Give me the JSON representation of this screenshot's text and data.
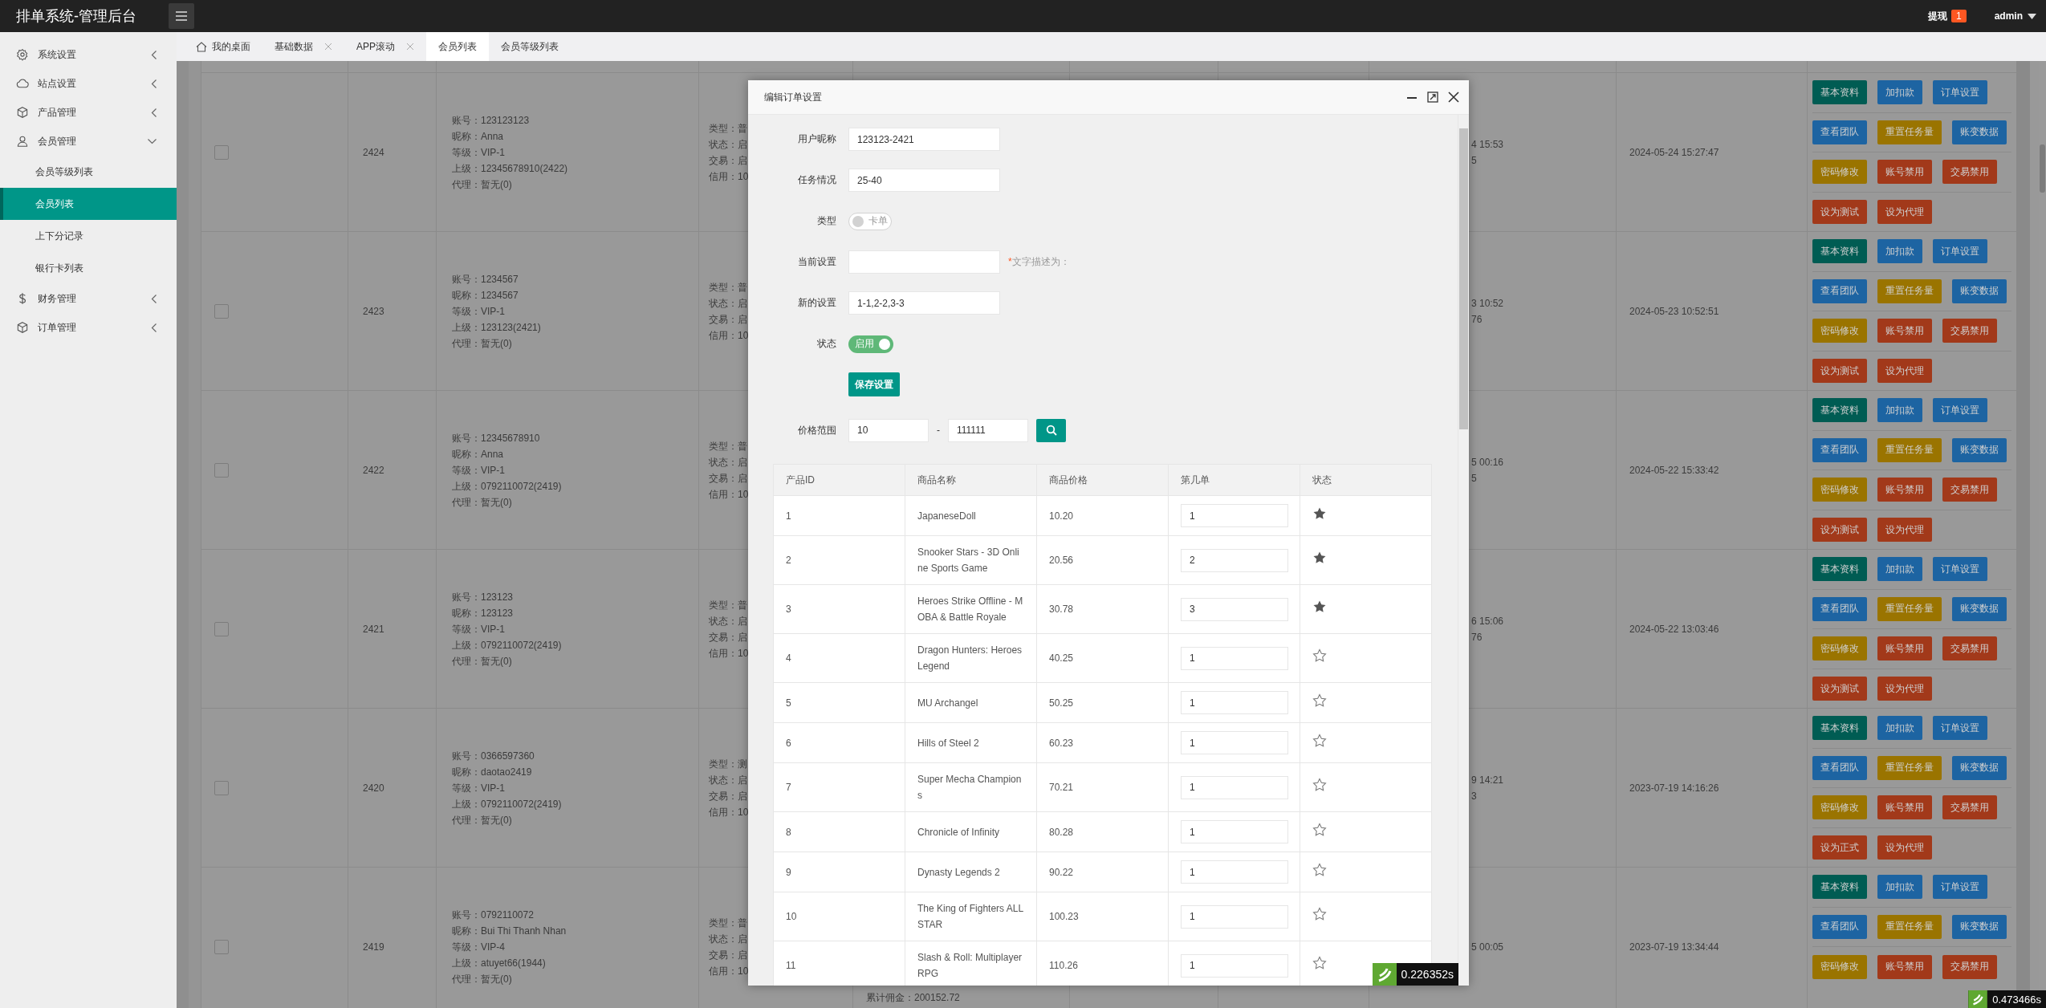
{
  "header": {
    "title": "排单系统-管理后台",
    "withdraw": {
      "label": "提现",
      "count": "1"
    },
    "user": "admin"
  },
  "sidebar": {
    "items": [
      {
        "label": "系统设置",
        "kind": "gear",
        "expanded": false
      },
      {
        "label": "站点设置",
        "kind": "cloud",
        "expanded": false
      },
      {
        "label": "产品管理",
        "kind": "cube",
        "expanded": false
      },
      {
        "label": "会员管理",
        "kind": "user",
        "expanded": true,
        "children": [
          {
            "label": "会员等级列表",
            "selected": false
          },
          {
            "label": "会员列表",
            "selected": true
          },
          {
            "label": "上下分记录",
            "selected": false
          },
          {
            "label": "银行卡列表",
            "selected": false
          }
        ]
      },
      {
        "label": "财务管理",
        "kind": "dollar",
        "expanded": false
      },
      {
        "label": "订单管理",
        "kind": "cube",
        "expanded": false
      }
    ]
  },
  "tabs": [
    {
      "label": "我的桌面",
      "kind": "home",
      "closable": false,
      "selected": false
    },
    {
      "label": "基础数据",
      "kind": "page",
      "closable": true,
      "selected": false
    },
    {
      "label": "APP滚动",
      "kind": "page",
      "closable": true,
      "selected": false
    },
    {
      "label": "会员列表",
      "kind": "page",
      "closable": false,
      "selected": true
    },
    {
      "label": "会员等级列表",
      "kind": "page",
      "closable": false,
      "selected": false
    }
  ],
  "members": {
    "rows": [
      {
        "checked": false,
        "id": "2424",
        "info": [
          "账号：123123123",
          "昵称：Anna",
          "等级：VIP-1",
          "上级：12345678910(2422)",
          "代理：暂无(0)"
        ],
        "type_lines": [
          "类型：普",
          "状态：启",
          "交易：启",
          "信用：10"
        ],
        "time_lines": [
          "4 15:53",
          "5"
        ],
        "date": "2024-05-24 15:27:47",
        "actions": [
          [
            {
              "label": "基本资料",
              "kind": "teal"
            },
            {
              "label": "加扣款",
              "kind": "blue"
            },
            {
              "label": "订单设置",
              "kind": "blue"
            }
          ],
          [
            {
              "label": "查看团队",
              "kind": "blue"
            },
            {
              "label": "重置任务量",
              "kind": "gold"
            },
            {
              "label": "账变数据",
              "kind": "blue"
            }
          ],
          [
            {
              "label": "密码修改",
              "kind": "gold"
            },
            {
              "label": "账号禁用",
              "kind": "red"
            },
            {
              "label": "交易禁用",
              "kind": "red"
            }
          ],
          [
            {
              "label": "设为测试",
              "kind": "red"
            },
            {
              "label": "设为代理",
              "kind": "red"
            }
          ]
        ]
      },
      {
        "checked": false,
        "id": "2423",
        "info": [
          "账号：1234567",
          "昵称：1234567",
          "等级：VIP-1",
          "上级：123123(2421)",
          "代理：暂无(0)"
        ],
        "type_lines": [
          "类型：普",
          "状态：启",
          "交易：启",
          "信用：10"
        ],
        "time_lines": [
          "3 10:52",
          "76"
        ],
        "date": "2024-05-23 10:52:51",
        "actions": [
          [
            {
              "label": "基本资料",
              "kind": "teal"
            },
            {
              "label": "加扣款",
              "kind": "blue"
            },
            {
              "label": "订单设置",
              "kind": "blue"
            }
          ],
          [
            {
              "label": "查看团队",
              "kind": "blue"
            },
            {
              "label": "重置任务量",
              "kind": "gold"
            },
            {
              "label": "账变数据",
              "kind": "blue"
            }
          ],
          [
            {
              "label": "密码修改",
              "kind": "gold"
            },
            {
              "label": "账号禁用",
              "kind": "red"
            },
            {
              "label": "交易禁用",
              "kind": "red"
            }
          ],
          [
            {
              "label": "设为测试",
              "kind": "red"
            },
            {
              "label": "设为代理",
              "kind": "red"
            }
          ]
        ]
      },
      {
        "checked": false,
        "id": "2422",
        "info": [
          "账号：12345678910",
          "昵称：Anna",
          "等级：VIP-1",
          "上级：0792110072(2419)",
          "代理：暂无(0)"
        ],
        "type_lines": [
          "类型：普",
          "状态：启",
          "交易：启",
          "信用：10"
        ],
        "time_lines": [
          "5 00:16",
          "5"
        ],
        "date": "2024-05-22 15:33:42",
        "actions": [
          [
            {
              "label": "基本资料",
              "kind": "teal"
            },
            {
              "label": "加扣款",
              "kind": "blue"
            },
            {
              "label": "订单设置",
              "kind": "blue"
            }
          ],
          [
            {
              "label": "查看团队",
              "kind": "blue"
            },
            {
              "label": "重置任务量",
              "kind": "gold"
            },
            {
              "label": "账变数据",
              "kind": "blue"
            }
          ],
          [
            {
              "label": "密码修改",
              "kind": "gold"
            },
            {
              "label": "账号禁用",
              "kind": "red"
            },
            {
              "label": "交易禁用",
              "kind": "red"
            }
          ],
          [
            {
              "label": "设为测试",
              "kind": "red"
            },
            {
              "label": "设为代理",
              "kind": "red"
            }
          ]
        ]
      },
      {
        "checked": false,
        "id": "2421",
        "info": [
          "账号：123123",
          "昵称：123123",
          "等级：VIP-1",
          "上级：0792110072(2419)",
          "代理：暂无(0)"
        ],
        "type_lines": [
          "类型：普",
          "状态：启",
          "交易：启",
          "信用：10"
        ],
        "time_lines": [
          "6 15:06",
          "76"
        ],
        "date": "2024-05-22 13:03:46",
        "actions": [
          [
            {
              "label": "基本资料",
              "kind": "teal"
            },
            {
              "label": "加扣款",
              "kind": "blue"
            },
            {
              "label": "订单设置",
              "kind": "blue"
            }
          ],
          [
            {
              "label": "查看团队",
              "kind": "blue"
            },
            {
              "label": "重置任务量",
              "kind": "gold"
            },
            {
              "label": "账变数据",
              "kind": "blue"
            }
          ],
          [
            {
              "label": "密码修改",
              "kind": "gold"
            },
            {
              "label": "账号禁用",
              "kind": "red"
            },
            {
              "label": "交易禁用",
              "kind": "red"
            }
          ],
          [
            {
              "label": "设为测试",
              "kind": "red"
            },
            {
              "label": "设为代理",
              "kind": "red"
            }
          ]
        ]
      },
      {
        "checked": false,
        "id": "2420",
        "info": [
          "账号：0366597360",
          "昵称：daotao2419",
          "等级：VIP-1",
          "上级：0792110072(2419)",
          "代理：暂无(0)"
        ],
        "type_lines": [
          "类型：测",
          "状态：启",
          "交易：启",
          "信用：10"
        ],
        "time_lines": [
          "9 14:21",
          "3"
        ],
        "date": "2023-07-19 14:16:26",
        "actions": [
          [
            {
              "label": "基本资料",
              "kind": "teal"
            },
            {
              "label": "加扣款",
              "kind": "blue"
            },
            {
              "label": "订单设置",
              "kind": "blue"
            }
          ],
          [
            {
              "label": "查看团队",
              "kind": "blue"
            },
            {
              "label": "重置任务量",
              "kind": "gold"
            },
            {
              "label": "账变数据",
              "kind": "blue"
            }
          ],
          [
            {
              "label": "密码修改",
              "kind": "gold"
            },
            {
              "label": "账号禁用",
              "kind": "red"
            },
            {
              "label": "交易禁用",
              "kind": "red"
            }
          ],
          [
            {
              "label": "设为正式",
              "kind": "red"
            },
            {
              "label": "设为代理",
              "kind": "red"
            }
          ]
        ]
      },
      {
        "checked": false,
        "id": "2419",
        "info": [
          "账号：0792110072",
          "昵称：Bui Thi Thanh Nhan",
          "等级：VIP-4",
          "上级：atuyet66(1944)",
          "代理：暂无(0)"
        ],
        "type_lines": [
          "类型：普",
          "状态：启",
          "交易：启",
          "信用：10"
        ],
        "column_5": "累计佣金：200152.72",
        "time_lines": [
          "5 00:05"
        ],
        "date": "2023-07-19 13:34:44",
        "actions": [
          [
            {
              "label": "基本资料",
              "kind": "teal"
            },
            {
              "label": "加扣款",
              "kind": "blue"
            },
            {
              "label": "订单设置",
              "kind": "blue"
            }
          ],
          [
            {
              "label": "查看团队",
              "kind": "blue"
            },
            {
              "label": "重置任务量",
              "kind": "gold"
            },
            {
              "label": "账变数据",
              "kind": "blue"
            }
          ],
          [
            {
              "label": "密码修改",
              "kind": "gold"
            },
            {
              "label": "账号禁用",
              "kind": "red"
            },
            {
              "label": "交易禁用",
              "kind": "red"
            }
          ]
        ]
      }
    ]
  },
  "modal": {
    "title": "编辑订单设置",
    "fields": [
      {
        "label": "用户昵称",
        "kind": "input",
        "value": "123123-2421"
      },
      {
        "label": "任务情况",
        "kind": "input",
        "value": "25-40"
      },
      {
        "label": "类型",
        "kind": "switch",
        "on": false,
        "text": "卡单"
      },
      {
        "label": "当前设置",
        "kind": "input",
        "required_mark": "*",
        "hint": "文字描述为："
      },
      {
        "label": "新的设置",
        "kind": "input",
        "value": "1-1,2-2,3-3"
      },
      {
        "label": "状态",
        "kind": "switch",
        "on": true,
        "text": "启用"
      }
    ],
    "save_button": "保存设置",
    "price_range": {
      "label": "价格范围",
      "min": "10",
      "separator": "-",
      "max": "111111"
    },
    "table": {
      "columns": [
        "产品ID",
        "商品名称",
        "商品价格",
        "第几单",
        "状态"
      ],
      "rows": [
        {
          "id": "1",
          "name": "JapaneseDoll",
          "price": "10.20",
          "order": "1",
          "starred": true
        },
        {
          "id": "2",
          "name": "Snooker Stars - 3D Online Sports Game",
          "price": "20.56",
          "order": "2",
          "starred": true
        },
        {
          "id": "3",
          "name": "Heroes Strike Offline - MOBA & Battle Royale",
          "price": "30.78",
          "order": "3",
          "starred": true
        },
        {
          "id": "4",
          "name": "Dragon Hunters: Heroes Legend",
          "price": "40.25",
          "order": "1",
          "starred": false
        },
        {
          "id": "5",
          "name": "MU Archangel",
          "price": "50.25",
          "order": "1",
          "starred": false
        },
        {
          "id": "6",
          "name": "Hills of Steel 2",
          "price": "60.23",
          "order": "1",
          "starred": false
        },
        {
          "id": "7",
          "name": "Super Mecha Champions",
          "price": "70.21",
          "order": "1",
          "starred": false
        },
        {
          "id": "8",
          "name": "Chronicle of Infinity",
          "price": "80.28",
          "order": "1",
          "starred": false
        },
        {
          "id": "9",
          "name": "Dynasty Legends 2",
          "price": "90.22",
          "order": "1",
          "starred": false
        },
        {
          "id": "10",
          "name": "The King of Fighters ALL STAR",
          "price": "100.23",
          "order": "1",
          "starred": false
        },
        {
          "id": "11",
          "name": "Slash & Roll: Multiplayer RPG",
          "price": "110.26",
          "order": "1",
          "starred": false
        }
      ]
    },
    "trace": "0.226352s"
  },
  "page_trace": "0.473466s"
}
